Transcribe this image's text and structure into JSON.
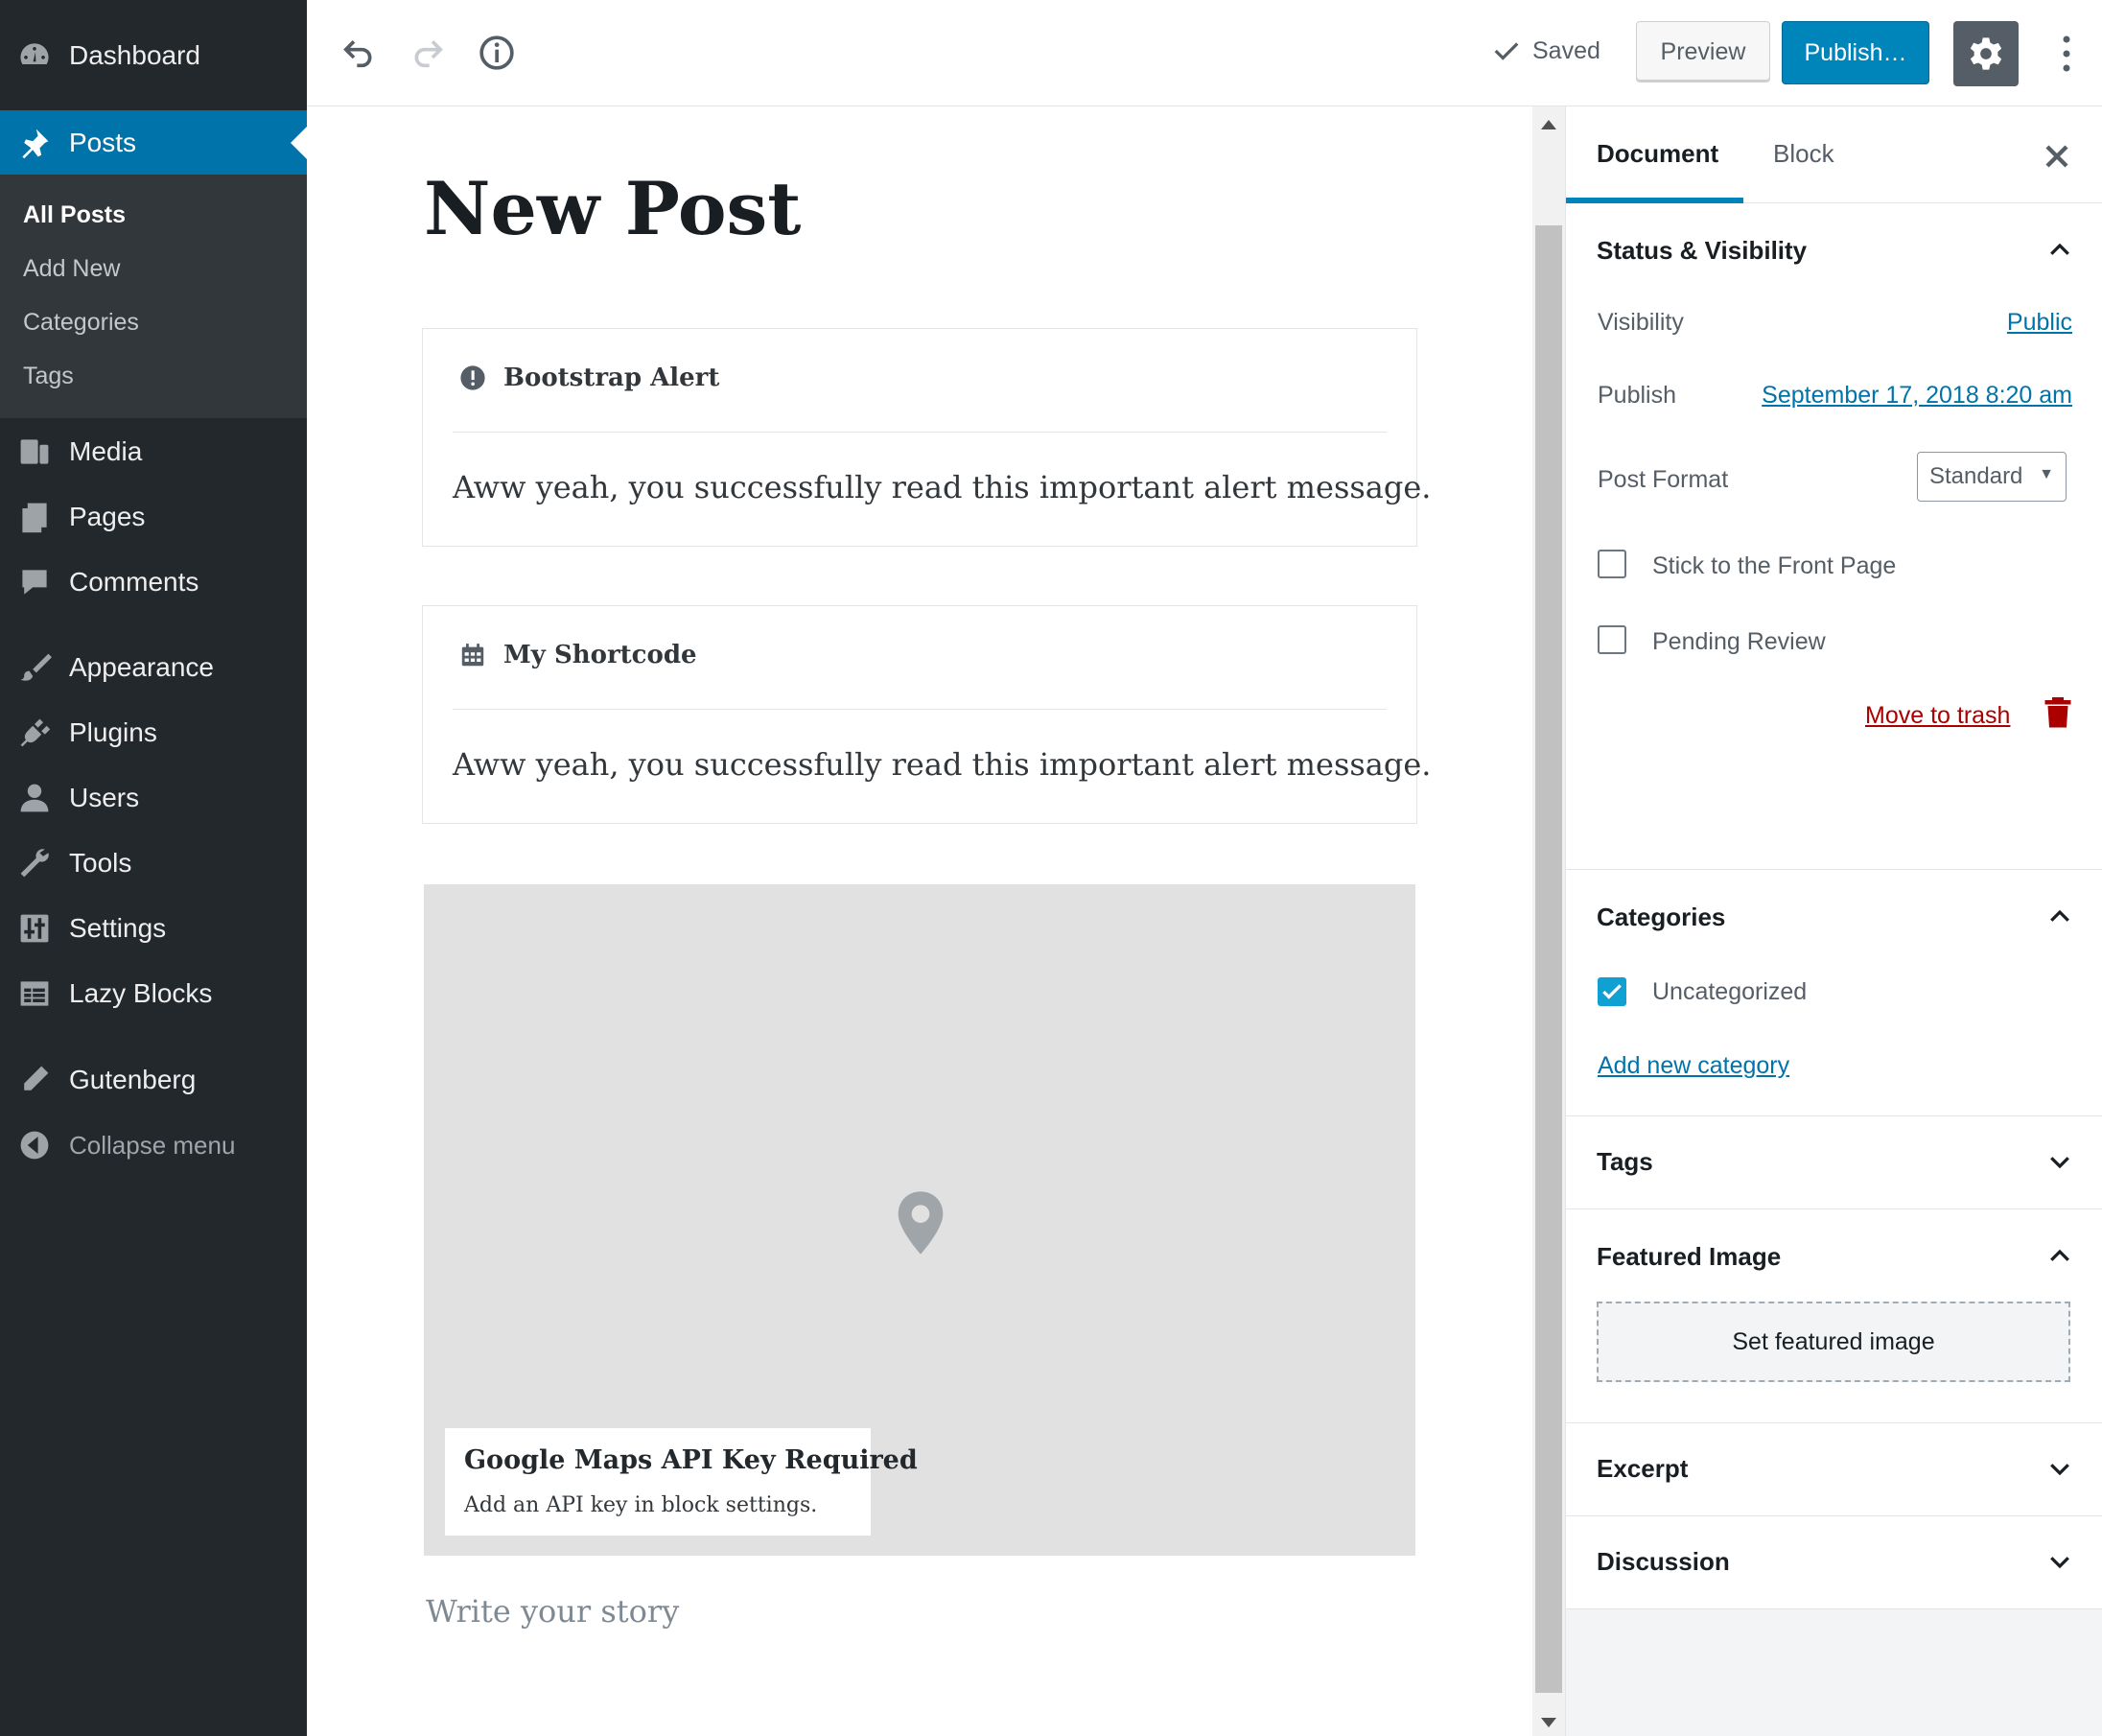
{
  "admin_menu": {
    "dashboard": "Dashboard",
    "posts": "Posts",
    "posts_submenu": [
      "All Posts",
      "Add New",
      "Categories",
      "Tags"
    ],
    "media": "Media",
    "pages": "Pages",
    "comments": "Comments",
    "appearance": "Appearance",
    "plugins": "Plugins",
    "users": "Users",
    "tools": "Tools",
    "settings": "Settings",
    "lazy_blocks": "Lazy Blocks",
    "gutenberg": "Gutenberg",
    "collapse": "Collapse menu"
  },
  "toolbar": {
    "saved_label": "Saved",
    "preview_label": "Preview",
    "publish_label": "Publish…"
  },
  "editor": {
    "title": "New Post",
    "blocks": [
      {
        "name": "Bootstrap Alert",
        "icon": "alert-icon",
        "content": "Aww yeah, you successfully read this important alert message."
      },
      {
        "name": "My Shortcode",
        "icon": "calendar-icon",
        "content": "Aww yeah, you successfully read this important alert message."
      }
    ],
    "map": {
      "title": "Google Maps API Key Required",
      "description": "Add an API key in block settings."
    },
    "placeholder": "Write your story"
  },
  "sidebar": {
    "tabs": [
      "Document",
      "Block"
    ],
    "status": {
      "title": "Status & Visibility",
      "visibility_label": "Visibility",
      "visibility_value": "Public",
      "publish_label": "Publish",
      "publish_value": "September 17, 2018 8:20 am",
      "format_label": "Post Format",
      "format_value": "Standard",
      "stick_label": "Stick to the Front Page",
      "pending_label": "Pending Review",
      "trash_label": "Move to trash"
    },
    "categories": {
      "title": "Categories",
      "items": [
        {
          "label": "Uncategorized",
          "checked": true
        }
      ],
      "add_new": "Add new category"
    },
    "tags_title": "Tags",
    "featured": {
      "title": "Featured Image",
      "button": "Set featured image"
    },
    "excerpt_title": "Excerpt",
    "discussion_title": "Discussion"
  },
  "colors": {
    "admin_bg": "#23282d",
    "accent": "#0073aa",
    "publish": "#0085ba",
    "trash": "#aa0000"
  }
}
